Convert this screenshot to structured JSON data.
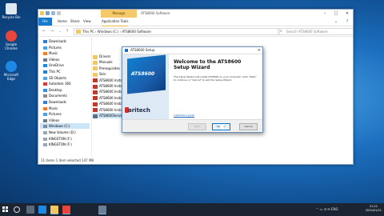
{
  "desktop": {
    "icons": [
      {
        "label": "Recycle Bin",
        "color": "#dfe8f0"
      },
      {
        "label": "Google Chrome",
        "color": "#e8453c"
      },
      {
        "label": "Microsoft Edge",
        "color": "#1e88e5"
      }
    ]
  },
  "explorer": {
    "context_tab": "Manage",
    "title": "ATS8600 Software",
    "tabs": [
      "File",
      "Home",
      "Share",
      "View",
      "Application Tools"
    ],
    "path": "This PC  ›  Windows (C:)  ›  ATS8600 Software",
    "search_placeholder": "Search ATS8600 Software",
    "nav": [
      {
        "label": "Downloads",
        "icon_color": "#3a7bd5"
      },
      {
        "label": "Pictures",
        "icon_color": "#4aa0e6"
      },
      {
        "label": "Music",
        "icon_color": "#f07b2b"
      },
      {
        "label": "Videos",
        "icon_color": "#6c7a89"
      },
      {
        "label": "OneDrive",
        "icon_color": "#1f88e5"
      },
      {
        "label": "This PC",
        "icon_color": "#2f7fcf"
      },
      {
        "label": "3D Objects",
        "icon_color": "#5ba3e0"
      },
      {
        "label": "Autodesk 360",
        "icon_color": "#d33b3b"
      },
      {
        "label": "Desktop",
        "icon_color": "#3b8be0"
      },
      {
        "label": "Documents",
        "icon_color": "#8a8a8a"
      },
      {
        "label": "Downloads",
        "icon_color": "#3a7bd5"
      },
      {
        "label": "Music",
        "icon_color": "#f07b2b"
      },
      {
        "label": "Pictures",
        "icon_color": "#4aa0e6"
      },
      {
        "label": "Videos",
        "icon_color": "#6c7a89"
      },
      {
        "label": "Windows (C:)",
        "icon_color": "#7d8fa3"
      },
      {
        "label": "New Volume (D:)",
        "icon_color": "#9aa6b2"
      },
      {
        "label": "KINGSTON (F:)",
        "icon_color": "#9aa6b2"
      },
      {
        "label": "KINGSTON (F:)",
        "icon_color": "#9aa6b2"
      }
    ],
    "files": [
      {
        "name": "Drivers",
        "icon_color": "#f2c760"
      },
      {
        "name": "Manuals",
        "icon_color": "#f2c760"
      },
      {
        "name": "Prerequisites",
        "icon_color": "#f2c760"
      },
      {
        "name": "Skin",
        "icon_color": "#f2c760"
      },
      {
        "name": "ATS8600 Install Gui",
        "icon_color": "#c0392b"
      },
      {
        "name": "ATS8600 Install Gui",
        "icon_color": "#c0392b"
      },
      {
        "name": "ATS8600 Install Gui",
        "icon_color": "#c0392b"
      },
      {
        "name": "ATS8600 Install Gui",
        "icon_color": "#c0392b"
      },
      {
        "name": "ATS8600 Install Gui",
        "icon_color": "#c0392b"
      },
      {
        "name": "ATS8600 Install Gui",
        "icon_color": "#c0392b"
      },
      {
        "name": "ATS8600ServerSetu",
        "icon_color": "#5b6f85"
      }
    ],
    "status": "11 items     1 item selected  147 MB"
  },
  "dialog": {
    "title": "ATS8600 Setup",
    "logo_text": "ATS8600",
    "brand": "aritech",
    "welcome": "Welcome to the ATS8600 Setup Wizard",
    "body": "The Setup Wizard will install ATS8600 on your computer. Click \"Next\" to continue or \"Cancel\" to exit the Setup Wizard.",
    "link": "Installation guide",
    "buttons": {
      "back": "Back",
      "next": "Next >",
      "cancel": "Cancel"
    }
  },
  "taskbar": {
    "clock_time": "21:21",
    "clock_date": "2020/01/21",
    "apps": [
      {
        "name": "task-view",
        "color": "#5a6a7c"
      },
      {
        "name": "edge",
        "color": "#1e88e5"
      },
      {
        "name": "explorer",
        "color": "#f2c760"
      },
      {
        "name": "chrome",
        "color": "#e8453c"
      },
      {
        "name": "setup",
        "color": "#6b7f95"
      }
    ]
  }
}
